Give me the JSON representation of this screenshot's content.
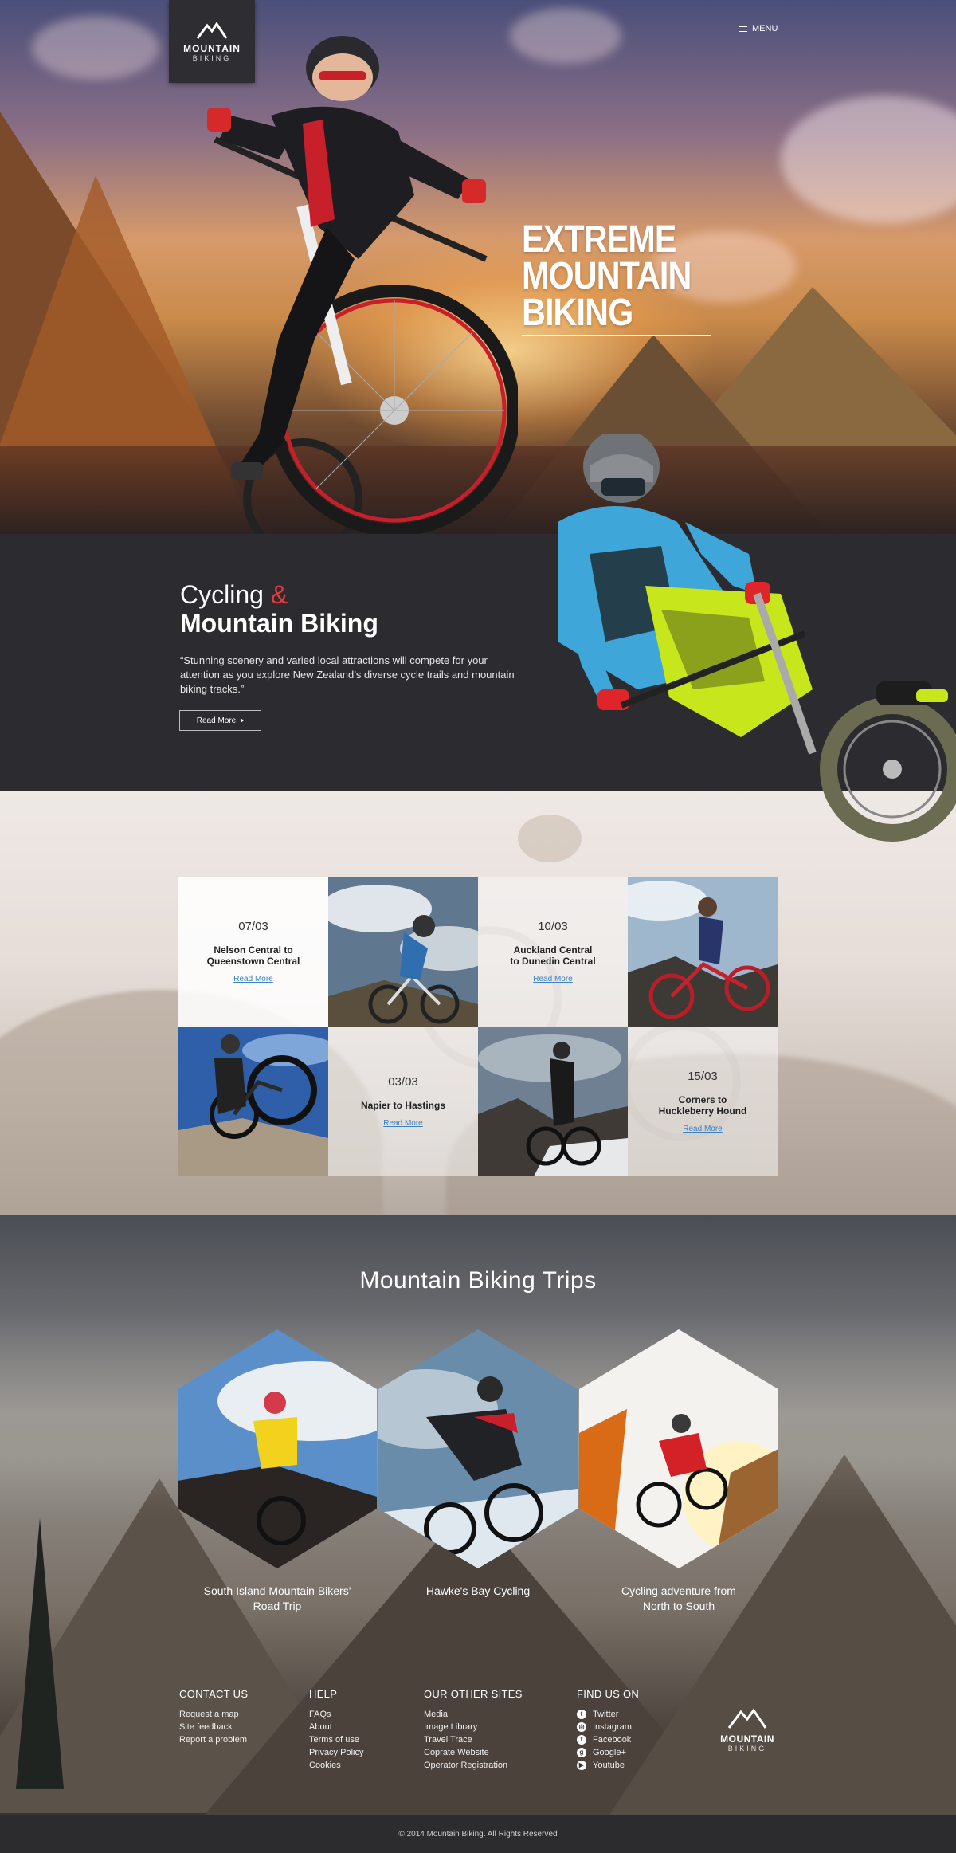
{
  "header": {
    "logo": {
      "title": "MOUNTAIN",
      "subtitle": "BIKING"
    },
    "menu_label": "MENU"
  },
  "hero": {
    "title_lines": [
      "EXTREME",
      "MOUNTAIN",
      "BIKING"
    ]
  },
  "intro": {
    "heading_line1": "Cycling",
    "heading_amp": "&",
    "heading_line2": "Mountain Biking",
    "quote": "“Stunning scenery and varied local attractions will compete for your attention as you explore New Zealand’s diverse cycle trails and mountain biking tracks.”",
    "button_label": "Read More"
  },
  "events": [
    {
      "date": "07/03",
      "title_line1": "Nelson Central to",
      "title_line2": "Queenstown Central",
      "link": "Read More"
    },
    {
      "date": "10/03",
      "title_line1": "Auckland Central",
      "title_line2": "to Dunedin Central",
      "link": "Read More"
    },
    {
      "date": "03/03",
      "title_line1": "Napier to Hastings",
      "title_line2": "",
      "link": "Read More"
    },
    {
      "date": "15/03",
      "title_line1": "Corners to",
      "title_line2": "Huckleberry Hound",
      "link": "Read More"
    }
  ],
  "trips": {
    "title": "Mountain Biking Trips",
    "items": [
      {
        "line1": "South Island Mountain Bikers'",
        "line2": "Road Trip"
      },
      {
        "line1": "Hawke's Bay Cycling",
        "line2": ""
      },
      {
        "line1": "Cycling adventure from",
        "line2": "North to South"
      }
    ]
  },
  "footer": {
    "contact": {
      "heading": "CONTACT US",
      "items": [
        "Request a map",
        "Site feedback",
        "Report a problem"
      ]
    },
    "help": {
      "heading": "HELP",
      "items": [
        "FAQs",
        "About",
        "Terms of use",
        "Privacy Policy",
        "Cookies"
      ]
    },
    "other": {
      "heading": "OUR OTHER SITES",
      "items": [
        "Media",
        "Image Library",
        "Travel Trace",
        "Coprate Website",
        "Operator Registration"
      ]
    },
    "social": {
      "heading": "FIND US ON",
      "items": [
        {
          "label": "Twitter",
          "icon": "twitter-icon"
        },
        {
          "label": "Instagram",
          "icon": "instagram-icon"
        },
        {
          "label": "Facebook",
          "icon": "facebook-icon"
        },
        {
          "label": "Google+",
          "icon": "google-plus-icon"
        },
        {
          "label": "Youtube",
          "icon": "youtube-icon"
        }
      ]
    },
    "logo": {
      "title": "MOUNTAIN",
      "subtitle": "BIKING"
    },
    "copyright": "© 2014 Mountain Biking. All Rights Reserved"
  },
  "colors": {
    "accent": "#e23b3b",
    "link": "#3b82c4",
    "dark": "#2c2c30"
  }
}
